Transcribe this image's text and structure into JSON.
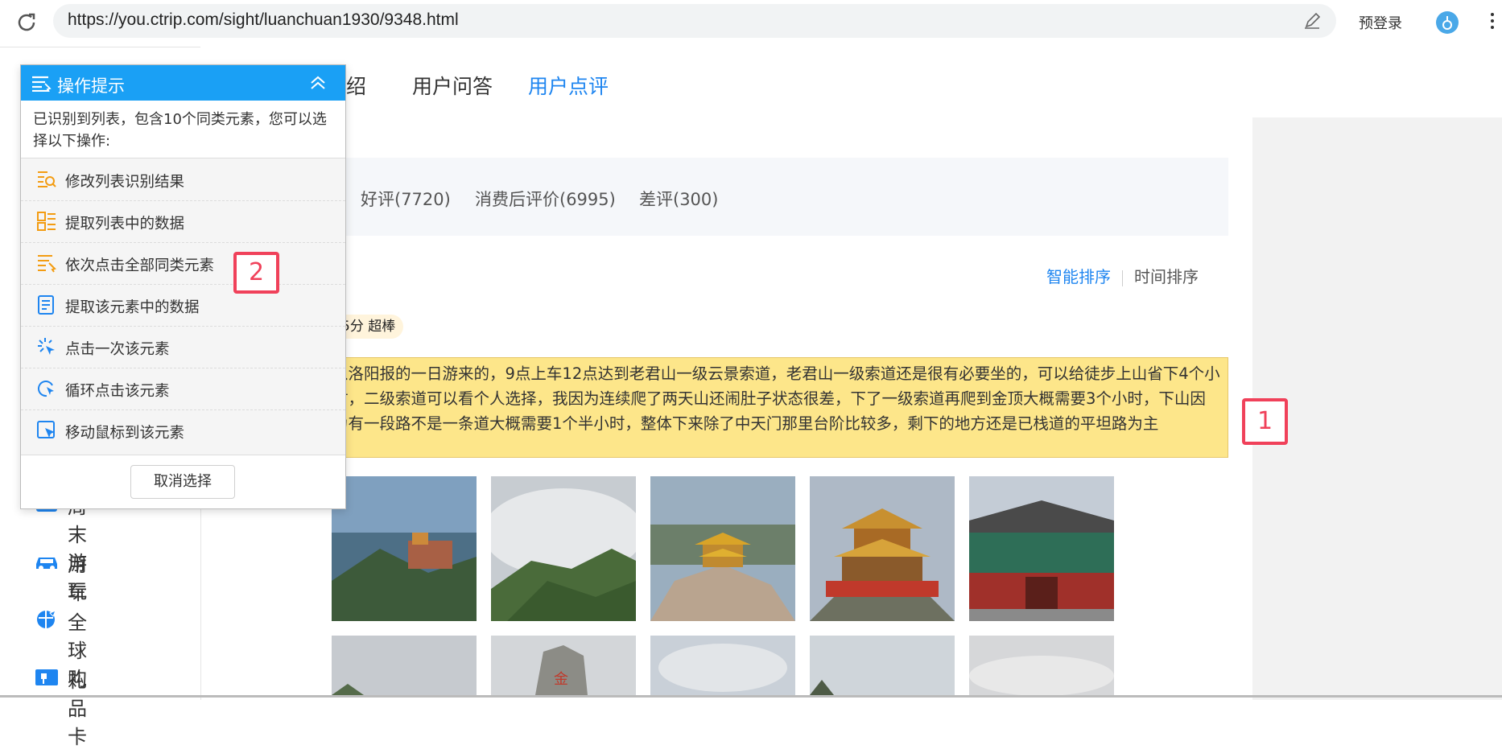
{
  "browser": {
    "url": "https://you.ctrip.com/sight/luanchuan1930/9348.html",
    "login_label": "预登录"
  },
  "nav": {
    "tabs": [
      {
        "label": "介绍"
      },
      {
        "label": "用户问答"
      },
      {
        "label": "用户点评"
      }
    ]
  },
  "filters": [
    {
      "label": "好评(7720)"
    },
    {
      "label": "消费后评价(6995)"
    },
    {
      "label": "差评(300)"
    }
  ],
  "sort": {
    "smart": "智能排序",
    "time": "时间排序"
  },
  "review": {
    "rating": "5分 超棒",
    "text": "从洛阳报的一日游来的，9点上车12点达到老君山一级云景索道，老君山一级索道还是很有必要坐的，可以给徒步上山省下4个小时，二级索道可以看个人选择，我因为连续爬了两天山还闹肚子状态很差，下了一级索道再爬到金顶大概需要3个小时，下山因为有一段路不是一条道大概需要1个半小时，整体下来除了中天门那里台阶比较多，剩下的地方还是已栈道的平坦路为主"
  },
  "sidebar": {
    "items": [
      {
        "label": "周末游玩"
      },
      {
        "label": "用车"
      },
      {
        "label": "全球购"
      },
      {
        "label": "礼品卡"
      }
    ]
  },
  "panel": {
    "title": "操作提示",
    "description": "已识别到列表，包含10个同类元素，您可以选择以下操作:",
    "actions": [
      {
        "label": "修改列表识别结果",
        "icon": "list-search-icon"
      },
      {
        "label": "提取列表中的数据",
        "icon": "grid-extract-icon"
      },
      {
        "label": "依次点击全部同类元素",
        "icon": "list-click-icon"
      },
      {
        "label": "提取该元素中的数据",
        "icon": "document-extract-icon"
      },
      {
        "label": "点击一次该元素",
        "icon": "click-burst-icon"
      },
      {
        "label": "循环点击该元素",
        "icon": "loop-click-icon"
      },
      {
        "label": "移动鼠标到该元素",
        "icon": "mouse-move-icon"
      }
    ],
    "cancel_label": "取消选择"
  },
  "markers": {
    "one": "1",
    "two": "2"
  },
  "colors": {
    "accent": "#1e85f0",
    "panel_header": "#1aa0f5",
    "highlight": "#fde68a",
    "marker": "#f0415a"
  }
}
